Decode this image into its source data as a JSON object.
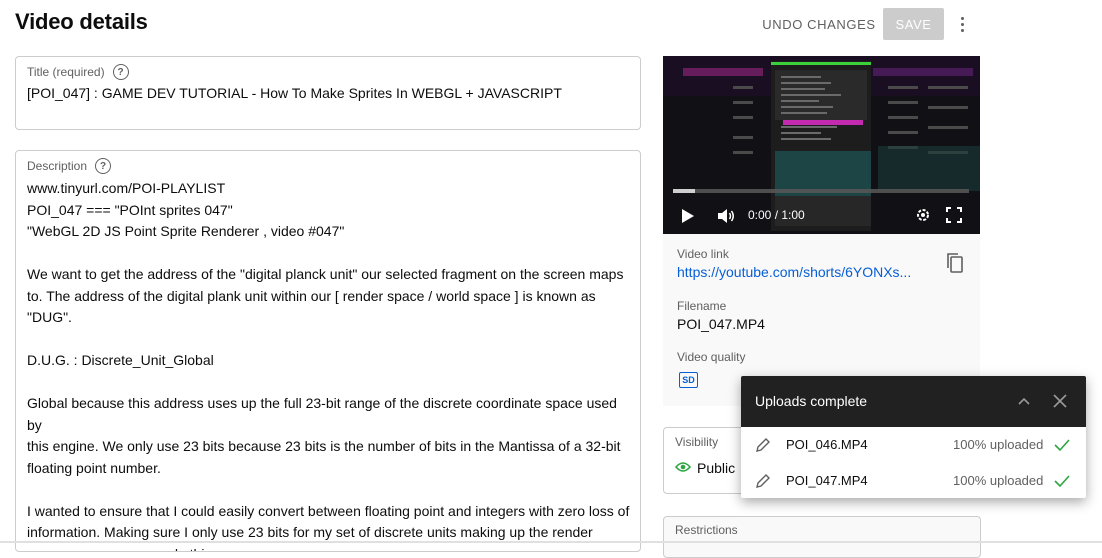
{
  "header": {
    "title": "Video details",
    "undo_label": "UNDO CHANGES",
    "save_label": "SAVE"
  },
  "title_field": {
    "label": "Title (required)",
    "value": "[POI_047] : GAME DEV TUTORIAL - How To Make Sprites In WEBGL + JAVASCRIPT"
  },
  "description": {
    "label": "Description",
    "lines": [
      "www.tinyurl.com/POI-PLAYLIST",
      "POI_047 === \"POInt sprites 047\"",
      "\"WebGL 2D JS Point Sprite Renderer , video #047\"",
      "",
      "We want to get the address of the \"digital planck unit\" our selected fragment on the screen maps",
      "to. The address of the digital plank unit within our [ render space / world space ] is known as",
      "\"DUG\".",
      "",
      "D.U.G. : Discrete_Unit_Global",
      "",
      "Global because this address uses up the full 23-bit range of the discrete coordinate space used by",
      "this engine. We only use 23 bits because 23 bits is the number of bits in the Mantissa of a 32-bit",
      "floating point number.",
      "",
      "I wanted to ensure that I could easily convert between floating point and integers with zero loss of",
      "information. Making sure I only use 23 bits for my set of discrete units making up the render",
      "space ensures we can do this."
    ]
  },
  "player": {
    "time": "0:00 / 1:00",
    "progress": 0.0
  },
  "video_info": {
    "link_label": "Video link",
    "link_text": "https://youtube.com/shorts/6YONXs...",
    "filename_label": "Filename",
    "filename": "POI_047.MP4",
    "quality_label": "Video quality",
    "quality_badge": "SD"
  },
  "visibility": {
    "label": "Visibility",
    "value": "Public"
  },
  "restrictions": {
    "label": "Restrictions"
  },
  "uploads_toast": {
    "title": "Uploads complete",
    "items": [
      {
        "name": "POI_046.MP4",
        "status": "100% uploaded"
      },
      {
        "name": "POI_047.MP4",
        "status": "100% uploaded"
      }
    ]
  },
  "colors": {
    "link": "#065fd4",
    "success": "#2ba640",
    "toast_header": "#212121"
  }
}
